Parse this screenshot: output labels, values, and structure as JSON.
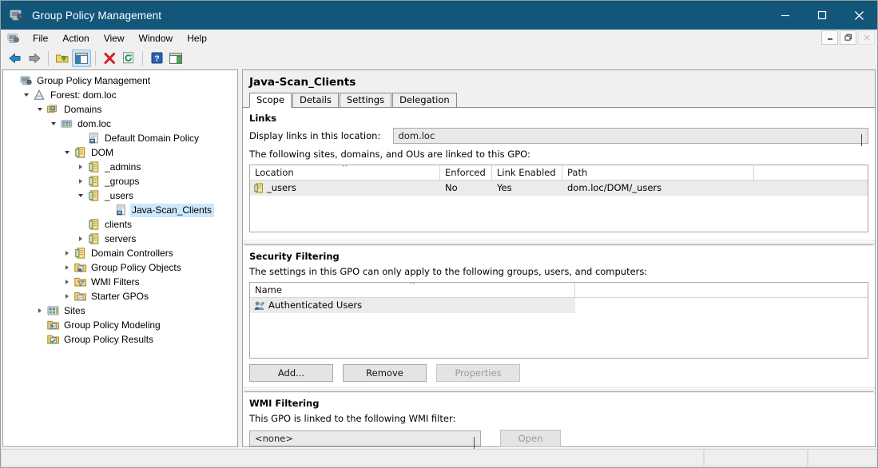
{
  "window": {
    "title": "Group Policy Management",
    "app_icon": "console-icon",
    "controls": {
      "minimize": "minimize-icon",
      "maximize": "maximize-icon",
      "close": "close-icon"
    },
    "mdi_controls": {
      "minimize": "mdi-minimize-icon",
      "restore": "mdi-restore-icon",
      "close": "mdi-close-icon"
    }
  },
  "menubar": {
    "icon": "console-small-icon",
    "items": [
      {
        "label": "File"
      },
      {
        "label": "Action"
      },
      {
        "label": "View"
      },
      {
        "label": "Window"
      },
      {
        "label": "Help"
      }
    ]
  },
  "toolbar": {
    "buttons": [
      {
        "name": "back-icon",
        "tip": "Back"
      },
      {
        "name": "forward-icon",
        "tip": "Forward"
      },
      {
        "name": "up-one-level-icon",
        "tip": "Up One Level"
      },
      {
        "name": "show-hide-console-tree-icon",
        "tip": "Show/Hide Console Tree",
        "pressed": true
      },
      {
        "name": "delete-icon",
        "tip": "Delete"
      },
      {
        "name": "refresh-icon",
        "tip": "Refresh"
      },
      {
        "name": "help-icon",
        "tip": "Help"
      },
      {
        "name": "show-hide-action-pane-icon",
        "tip": "Show/Hide Action Pane"
      }
    ]
  },
  "tree": {
    "items": [
      {
        "label": "Group Policy Management",
        "indent": 0,
        "expander": "none",
        "icon": "console-root-icon",
        "selected": false
      },
      {
        "label": "Forest: dom.loc",
        "indent": 1,
        "expander": "expanded",
        "icon": "forest-icon",
        "selected": false
      },
      {
        "label": "Domains",
        "indent": 2,
        "expander": "expanded",
        "icon": "domains-icon",
        "selected": false
      },
      {
        "label": "dom.loc",
        "indent": 3,
        "expander": "expanded",
        "icon": "domain-icon",
        "selected": false
      },
      {
        "label": "Default Domain Policy",
        "indent": 5,
        "expander": "none",
        "icon": "gpo-icon",
        "selected": false
      },
      {
        "label": "DOM",
        "indent": 4,
        "expander": "expanded",
        "icon": "ou-icon",
        "selected": false
      },
      {
        "label": "_admins",
        "indent": 5,
        "expander": "collapsed",
        "icon": "ou-icon",
        "selected": false
      },
      {
        "label": "_groups",
        "indent": 5,
        "expander": "collapsed",
        "icon": "ou-icon",
        "selected": false
      },
      {
        "label": "_users",
        "indent": 5,
        "expander": "expanded",
        "icon": "ou-icon",
        "selected": false
      },
      {
        "label": "Java-Scan_Clients",
        "indent": 7,
        "expander": "none",
        "icon": "gpo-link-icon",
        "selected": true
      },
      {
        "label": "clients",
        "indent": 5,
        "expander": "none",
        "icon": "ou-icon",
        "selected": false
      },
      {
        "label": "servers",
        "indent": 5,
        "expander": "collapsed",
        "icon": "ou-icon",
        "selected": false
      },
      {
        "label": "Domain Controllers",
        "indent": 4,
        "expander": "collapsed",
        "icon": "ou-icon",
        "selected": false
      },
      {
        "label": "Group Policy Objects",
        "indent": 4,
        "expander": "collapsed",
        "icon": "gpo-folder-icon",
        "selected": false
      },
      {
        "label": "WMI Filters",
        "indent": 4,
        "expander": "collapsed",
        "icon": "wmi-folder-icon",
        "selected": false
      },
      {
        "label": "Starter GPOs",
        "indent": 4,
        "expander": "collapsed",
        "icon": "starter-gpo-folder-icon",
        "selected": false
      },
      {
        "label": "Sites",
        "indent": 2,
        "expander": "collapsed",
        "icon": "sites-icon",
        "selected": false
      },
      {
        "label": "Group Policy Modeling",
        "indent": 2,
        "expander": "none",
        "icon": "modeling-icon",
        "selected": false
      },
      {
        "label": "Group Policy Results",
        "indent": 2,
        "expander": "none",
        "icon": "results-icon",
        "selected": false
      }
    ]
  },
  "detail": {
    "gpo_name": "Java-Scan_Clients",
    "tabs": [
      {
        "label": "Scope",
        "active": true
      },
      {
        "label": "Details",
        "active": false
      },
      {
        "label": "Settings",
        "active": false
      },
      {
        "label": "Delegation",
        "active": false
      }
    ],
    "links": {
      "heading": "Links",
      "location_label": "Display links in this location:",
      "location_value": "dom.loc",
      "list_caption": "The following sites, domains, and OUs are linked to this GPO:",
      "columns": [
        "Location",
        "Enforced",
        "Link Enabled",
        "Path"
      ],
      "sorted_column": "Location",
      "rows": [
        {
          "icon": "ou-icon",
          "location": "_users",
          "enforced": "No",
          "link_enabled": "Yes",
          "path": "dom.loc/DOM/_users"
        }
      ]
    },
    "security_filtering": {
      "heading": "Security Filtering",
      "caption": "The settings in this GPO can only apply to the following groups, users, and computers:",
      "columns": [
        "Name"
      ],
      "sorted_column": "Name",
      "rows": [
        {
          "icon": "users-group-icon",
          "name": "Authenticated Users"
        }
      ],
      "buttons": [
        {
          "label": "Add...",
          "disabled": false
        },
        {
          "label": "Remove",
          "disabled": false
        },
        {
          "label": "Properties",
          "disabled": true
        }
      ]
    },
    "wmi_filtering": {
      "heading": "WMI Filtering",
      "caption": "This GPO is linked to the following WMI filter:",
      "filter_value": "<none>",
      "open_button": {
        "label": "Open",
        "disabled": true
      }
    }
  },
  "statusbar": {
    "panes": [
      "",
      "",
      ""
    ]
  },
  "colors": {
    "titlebar": "#12577a",
    "selection": "#cce8ff",
    "row_alt": "#ebebeb",
    "panel_bg": "#f0f0f0",
    "combo_bg": "#e9e9e9"
  }
}
